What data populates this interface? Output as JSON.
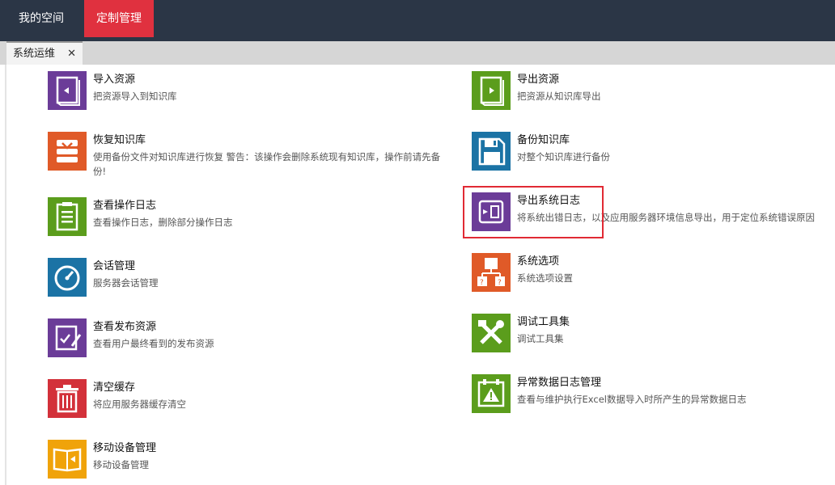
{
  "topnav": {
    "my_space": "我的空间",
    "custom_mgmt": "定制管理"
  },
  "tab": {
    "label": "系统运维",
    "close": "✕"
  },
  "colors": {
    "topbar": "#2b3646",
    "accent": "#e0313f"
  },
  "left_items": [
    {
      "title": "导入资源",
      "desc": "把资源导入到知识库",
      "icon": "import-book-icon",
      "color": "#6b3c98"
    },
    {
      "title": "恢复知识库",
      "desc": "使用备份文件对知识库进行恢复 警告：该操作会删除系统现有知识库，操作前请先备份!",
      "icon": "restore-stack-icon",
      "color": "#e05a28"
    },
    {
      "title": "查看操作日志",
      "desc": "查看操作日志，删除部分操作日志",
      "icon": "clipboard-log-icon",
      "color": "#5b9d1c"
    },
    {
      "title": "会话管理",
      "desc": "服务器会话管理",
      "icon": "gauge-icon",
      "color": "#1b73a5"
    },
    {
      "title": "查看发布资源",
      "desc": "查看用户最终看到的发布资源",
      "icon": "edit-check-icon",
      "color": "#6b3c98"
    },
    {
      "title": "清空缓存",
      "desc": "将应用服务器缓存清空",
      "icon": "trash-icon",
      "color": "#d3313a"
    },
    {
      "title": "移动设备管理",
      "desc": "移动设备管理",
      "icon": "mobile-book-icon",
      "color": "#f0a30a"
    }
  ],
  "right_items": [
    {
      "title": "导出资源",
      "desc": "把资源从知识库导出",
      "icon": "export-book-icon",
      "color": "#5b9d1c"
    },
    {
      "title": "备份知识库",
      "desc": "对整个知识库进行备份",
      "icon": "floppy-save-icon",
      "color": "#1b73a5"
    },
    {
      "title": "导出系统日志",
      "desc": "将系统出错日志，以及应用服务器环境信息导出，用于定位系统错误原因",
      "icon": "export-log-icon",
      "color": "#6b3c98"
    },
    {
      "title": "系统选项",
      "desc": "系统选项设置",
      "icon": "options-tree-icon",
      "color": "#e05a28"
    },
    {
      "title": "调试工具集",
      "desc": "调试工具集",
      "icon": "tools-icon",
      "color": "#5b9d1c"
    },
    {
      "title": "异常数据日志管理",
      "desc": "查看与维护执行Excel数据导入时所产生的异常数据日志",
      "icon": "warning-calendar-icon",
      "color": "#5b9d1c"
    }
  ]
}
